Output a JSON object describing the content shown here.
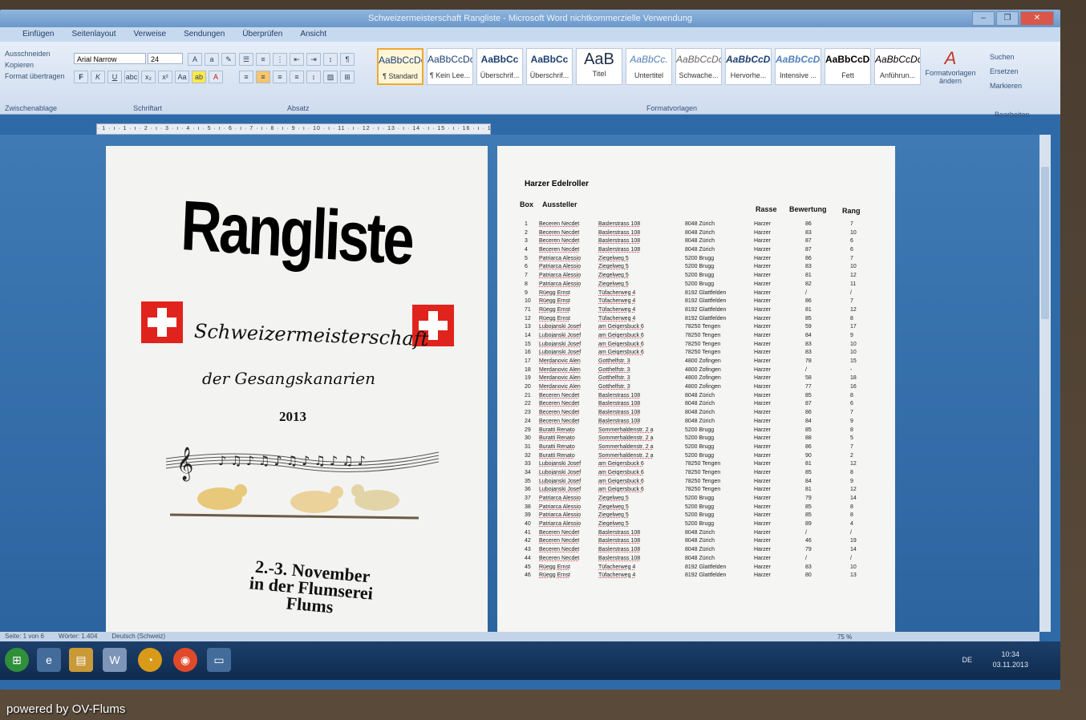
{
  "window": {
    "title": "Schweizermeisterschaft Rangliste - Microsoft Word nichtkommerzielle Verwendung"
  },
  "ribbon": {
    "tabs": [
      "Einfügen",
      "Seitenlayout",
      "Verweise",
      "Sendungen",
      "Überprüfen",
      "Ansicht"
    ],
    "clipboard_items": [
      "Ausschneiden",
      "Kopieren",
      "Format übertragen"
    ],
    "clipboard_label": "Zwischenablage",
    "font_name": "Arial Narrow",
    "font_size": "24",
    "font_label": "Schriftart",
    "paragraph_label": "Absatz",
    "styles_label": "Formatvorlagen",
    "styles": [
      {
        "preview": "AaBbCcDc",
        "name": "¶ Standard"
      },
      {
        "preview": "AaBbCcDc",
        "name": "¶ Kein Lee..."
      },
      {
        "preview": "AaBbCc",
        "name": "Überschrif..."
      },
      {
        "preview": "AaBbCc",
        "name": "Überschrif..."
      },
      {
        "preview": "AaB",
        "name": "Titel"
      },
      {
        "preview": "AaBbCc.",
        "name": "Untertitel"
      },
      {
        "preview": "AaBbCcDc",
        "name": "Schwache..."
      },
      {
        "preview": "AaBbCcDc",
        "name": "Hervorhe..."
      },
      {
        "preview": "AaBbCcDc",
        "name": "Intensive ..."
      },
      {
        "preview": "AaBbCcDc",
        "name": "Fett"
      },
      {
        "preview": "AaBbCcDc",
        "name": "Anführun..."
      }
    ],
    "change_styles": "Formatvorlagen ändern",
    "edit_items": [
      "Suchen",
      "Ersetzen",
      "Markieren"
    ],
    "edit_label": "Bearbeiten"
  },
  "ruler_text": "· 1 · ı · 1 · ı · 2 · ı · 3 · ı · 4 · ı · 5 · ı · 6 · ı · 7 · ı · 8 · ı · 9 · ı · 10 · ı · 11 · ı · 12 · ı · 13 · ı · 14 · ı · 15 · ı · 16 · ı · 17 · ı · 18 · 19",
  "page1": {
    "title": "Rangliste",
    "line1": "Schweizermeisterschaft",
    "line2": "der Gesangskanarien",
    "year": "2013",
    "date_line1": "2.-3. November",
    "date_line2": "in der Flumserei",
    "date_line3": "Flums"
  },
  "page2": {
    "title": "Harzer Edelroller",
    "headers": {
      "box": "Box",
      "aussteller": "Aussteller",
      "rasse": "Rasse",
      "bewertung": "Bewertung",
      "rang": "Rang"
    },
    "rows": [
      [
        "1",
        "Beceren Necdet",
        "Baslerstrass   108",
        "8048 Zürich",
        "Harzer",
        "86",
        "7"
      ],
      [
        "2",
        "Beceren Necdet",
        "Baslerstrass   108",
        "8048 Zürich",
        "Harzer",
        "83",
        "10"
      ],
      [
        "3",
        "Beceren Necdet",
        "Baslerstrass   108",
        "8048 Zürich",
        "Harzer",
        "87",
        "6"
      ],
      [
        "4",
        "Beceren Necdet",
        "Baslerstrass   108",
        "8048 Zürich",
        "Harzer",
        "87",
        "6"
      ],
      [
        "5",
        "Patriarca Alessio",
        "Ziegelweg 5",
        "5200 Brugg",
        "Harzer",
        "86",
        "7"
      ],
      [
        "6",
        "Patriarca Alessio",
        "Ziegelweg 5",
        "5200 Brugg",
        "Harzer",
        "83",
        "10"
      ],
      [
        "7",
        "Patriarca Alessio",
        "Ziegelweg 5",
        "5200 Brugg",
        "Harzer",
        "81",
        "12"
      ],
      [
        "8",
        "Patriarca Alessio",
        "Ziegelweg 5",
        "5200 Brugg",
        "Harzer",
        "82",
        "11"
      ],
      [
        "9",
        "Rüegg  Ernst",
        "Tüfacherweg 4",
        "8192 Glattfelden",
        "Harzer",
        "/",
        "/"
      ],
      [
        "10",
        "Rüegg  Ernst",
        "Tüfacherweg 4",
        "8192 Glattfelden",
        "Harzer",
        "86",
        "7"
      ],
      [
        "71",
        "Rüegg  Ernst",
        "Tüfacherweg 4",
        "8192 Glattfelden",
        "Harzer",
        "81",
        "12"
      ],
      [
        "12",
        "Rüegg  Ernst",
        "Tüfacherweg 4",
        "8192 Glattfelden",
        "Harzer",
        "85",
        "8"
      ],
      [
        "13",
        "Lubojanski Josef",
        "am Geigersbuck 6",
        "78250 Tengen",
        "Harzer",
        "59",
        "17"
      ],
      [
        "14",
        "Lubojanski Josef",
        "am Geigersbuck 6",
        "78250 Tengen",
        "Harzer",
        "84",
        "9"
      ],
      [
        "15",
        "Lubojanski Josef",
        "am Geigersbuck 6",
        "78250 Tengen",
        "Harzer",
        "83",
        "10"
      ],
      [
        "16",
        "Lubojanski Josef",
        "am Geigersbuck 6",
        "78250 Tengen",
        "Harzer",
        "83",
        "10"
      ],
      [
        "17",
        "Merdanovic Alen",
        "Gotthelfstr. 3",
        "4800 Zofingen",
        "Harzer",
        "78",
        "15"
      ],
      [
        "18",
        "Merdanovic Alen",
        "Gotthelfstr. 3",
        "4800 Zofingen",
        "Harzer",
        "/",
        "-"
      ],
      [
        "19",
        "Merdanovic Alen",
        "Gotthelfstr. 3",
        "4800 Zofingen",
        "Harzer",
        "58",
        "18"
      ],
      [
        "20",
        "Merdanovic Alen",
        "Gotthelfstr. 3",
        "4800 Zofingen",
        "Harzer",
        "77",
        "16"
      ],
      [
        "21",
        "Beceren Necdet",
        "Baslerstrass   108",
        "8048 Zürich",
        "Harzer",
        "85",
        "8"
      ],
      [
        "22",
        "Beceren Necdet",
        "Baslerstrass   108",
        "8048 Zürich",
        "Harzer",
        "87",
        "6"
      ],
      [
        "23",
        "Beceren Necdet",
        "Baslerstrass   108",
        "8048 Zürich",
        "Harzer",
        "86",
        "7"
      ],
      [
        "24",
        "Beceren Necdet",
        "Baslerstrass   108",
        "8048 Zürich",
        "Harzer",
        "84",
        "9"
      ],
      [
        "29",
        "Buratti Renato",
        "Sommerhaldenstr. 2 a",
        "5200 Brugg",
        "Harzer",
        "85",
        "8"
      ],
      [
        "30",
        "Buratti Renato",
        "Sommerhaldenstr. 2 a",
        "5200 Brugg",
        "Harzer",
        "88",
        "5"
      ],
      [
        "31",
        "Buratti Renato",
        "Sommerhaldenstr. 2 a",
        "5200 Brugg",
        "Harzer",
        "86",
        "7"
      ],
      [
        "32",
        "Buratti Renato",
        "Sommerhaldenstr. 2 a",
        "5200 Brugg",
        "Harzer",
        "90",
        "2"
      ],
      [
        "33",
        "Lubojanski Josef",
        "am Geigersbuck 6",
        "78250 Tengen",
        "Harzer",
        "81",
        "12"
      ],
      [
        "34",
        "Lubojanski Josef",
        "am Geigersbuck 6",
        "78250 Tengen",
        "Harzer",
        "85",
        "8"
      ],
      [
        "35",
        "Lubojanski Josef",
        "am Geigersbuck 6",
        "78250 Tengen",
        "Harzer",
        "84",
        "9"
      ],
      [
        "36",
        "Lubojanski Josef",
        "am Geigersbuck 6",
        "78250 Tengen",
        "Harzer",
        "81",
        "12"
      ],
      [
        "37",
        "Patriarca Alessio",
        "Ziegelweg 5",
        "5200 Brugg",
        "Harzer",
        "79",
        "14"
      ],
      [
        "38",
        "Patriarca Alessio",
        "Ziegelweg 5",
        "5200 Brugg",
        "Harzer",
        "85",
        "8"
      ],
      [
        "39",
        "Patriarca Alessio",
        "Ziegelweg 5",
        "5200 Brugg",
        "Harzer",
        "85",
        "8"
      ],
      [
        "40",
        "Patriarca Alessio",
        "Ziegelweg 5",
        "5200 Brugg",
        "Harzer",
        "89",
        "4"
      ],
      [
        "41",
        "Beceren Necdet",
        "Baslerstrass   108",
        "8048 Zürich",
        "Harzer",
        "/",
        "/"
      ],
      [
        "42",
        "Beceren Necdet",
        "Baslerstrass   108",
        "8048 Zürich",
        "Harzer",
        "46",
        "19"
      ],
      [
        "43",
        "Beceren Necdet",
        "Baslerstrass   108",
        "8048 Zürich",
        "Harzer",
        "79",
        "14"
      ],
      [
        "44",
        "Beceren Necdet",
        "Baslerstrass   108",
        "8048 Zürich",
        "Harzer",
        "/",
        "/"
      ],
      [
        "45",
        "Rüegg  Ernst",
        "Tüfacherweg 4",
        "8192 Glattfelden",
        "Harzer",
        "83",
        "10"
      ],
      [
        "46",
        "Rüegg  Ernst",
        "Tüfacherweg 4",
        "8192 Glattfelden",
        "Harzer",
        "80",
        "13"
      ]
    ]
  },
  "statusbar": {
    "page": "Seite: 1 von 6",
    "words": "Wörter: 1.404",
    "language": "Deutsch (Schweiz)",
    "zoom": "75 %"
  },
  "taskbar": {
    "lang": "DE",
    "time": "10:34",
    "date": "03.11.2013"
  },
  "watermark": "powered by OV-Flums"
}
